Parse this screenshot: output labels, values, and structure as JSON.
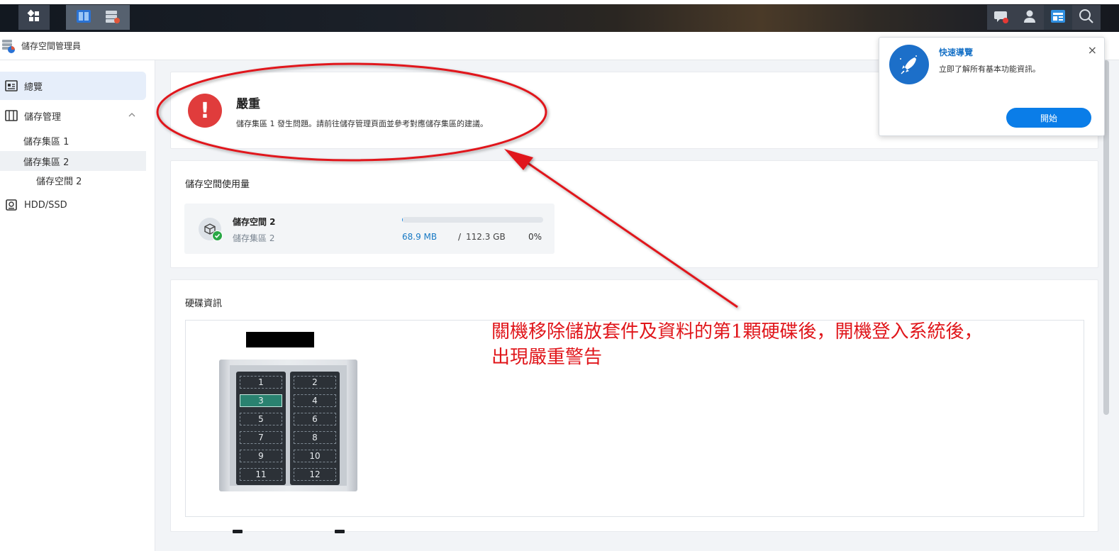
{
  "taskbar": {
    "apps": [
      "main-menu",
      "storage-manager"
    ]
  },
  "window": {
    "title": "儲存空間管理員"
  },
  "sidebar": {
    "overview": "總覽",
    "storage_management": "儲存管理",
    "pool1": "儲存集區 1",
    "pool2": "儲存集區 2",
    "volume2": "儲存空間 2",
    "hdd_ssd": "HDD/SSD"
  },
  "status": {
    "title": "嚴重",
    "description": "儲存集區 1 發生問題。請前往儲存管理頁面並參考對應儲存集區的建議。",
    "color": "#e03c3c"
  },
  "usage": {
    "heading": "儲存空間使用量",
    "volume_name": "儲存空間 2",
    "pool_name": "儲存集區 2",
    "used": "68.9 MB",
    "separator": "/",
    "total": "112.3 GB",
    "percent_text": "0%",
    "percent_value": 0.0006
  },
  "disk_info": {
    "heading": "硬碟資訊",
    "bays": [
      "1",
      "2",
      "3",
      "4",
      "5",
      "6",
      "7",
      "8",
      "9",
      "10",
      "11",
      "12"
    ],
    "selected_bay": "3"
  },
  "annotation": {
    "text": "關機移除儲放套件及資料的第1顆硬碟後，開機登入系統後，出現嚴重警告",
    "color": "#e0161b"
  },
  "quick_guide": {
    "title": "快速導覽",
    "description": "立即了解所有基本功能資訊。",
    "close": "×",
    "start_button": "開始"
  }
}
